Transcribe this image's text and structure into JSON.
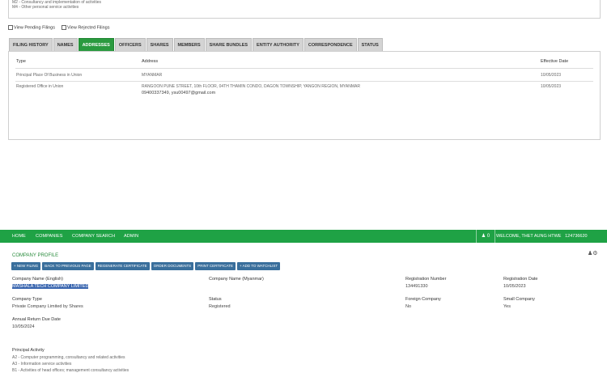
{
  "top": {
    "summary_lines": [
      "M2 - Consultancy and implementation of activities",
      "M4 - Other personal service activities"
    ],
    "filters": [
      "View Pending Filings",
      "View Rejected Filings"
    ],
    "tabs": [
      "FILING HISTORY",
      "NAMES",
      "ADDRESSES",
      "OFFICERS",
      "SHARES",
      "MEMBERS",
      "SHARE BUNDLES",
      "ENTITY AUTHORITY",
      "CORRESPONDENCE",
      "STATUS"
    ],
    "active_tab": "ADDRESSES",
    "columns": [
      "Type",
      "Address",
      "Effective Date"
    ],
    "rows": [
      {
        "type": "Principal Place Of Business in Union",
        "address": "MYANMAR",
        "email": "",
        "date": "10/05/2023"
      },
      {
        "type": "Registered Office in Union",
        "address": "RANGOON PUNE STREET, 10th FLOOR, 04TH THAMIN CONDO, DAGON TOWNSHIP, YANGON REGION, MYANMAR",
        "email": "09400337349, ysu00497@gmail.com",
        "date": "10/05/2023"
      }
    ]
  },
  "nav": {
    "links": [
      "HOME",
      "COMPANIES",
      "COMPANY SEARCH",
      "ADMIN"
    ],
    "user_count": "0",
    "welcome": "WELCOME, THET AUNG HTWE",
    "phone": "124736620"
  },
  "profile": {
    "title": "COMPANY PROFILE",
    "buttons": [
      "+ NEW FILING",
      "BACK TO PREVIOUS PAGE",
      "REGENERATE CERTIFICATE",
      "ORDER DOCUMENTS",
      "PRINT CERTIFICATE",
      "+ ADD TO WATCHLIST"
    ],
    "fields": {
      "name_en_label": "Company Name (English)",
      "name_en": "MASHALA TECH COMPANY LIMITED",
      "name_mm_label": "Company Name (Myanmar)",
      "name_mm": "",
      "reg_no_label": "Registration Number",
      "reg_no": "134491330",
      "reg_date_label": "Registration Date",
      "reg_date": "10/05/2023",
      "type_label": "Company Type",
      "type": "Private Company Limited by Shares",
      "status_label": "Status",
      "status": "Registered",
      "foreign_label": "Foreign Company",
      "foreign": "No",
      "small_label": "Small Company",
      "small": "Yes",
      "annual_label": "Annual Return Due Date",
      "annual": "10/05/2024"
    },
    "principal_activity_label": "Principal Activity",
    "activities": [
      "A2 - Computer programming, consultancy and related activities",
      "A3 - Information service activities",
      "B1 - Activities of head offices; management consultancy activities"
    ]
  },
  "colors": {
    "green": "#1fa245",
    "button_blue": "#3a6f9c",
    "highlight": "#3b67b0"
  }
}
